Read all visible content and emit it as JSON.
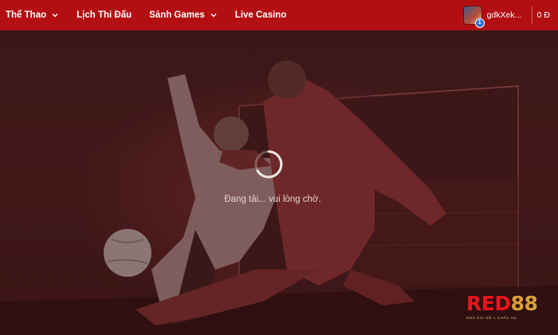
{
  "nav": {
    "items": [
      {
        "label": "Thể Thao",
        "has_dropdown": true
      },
      {
        "label": "Lịch Thi Đấu",
        "has_dropdown": false
      },
      {
        "label": "Sảnh Games",
        "has_dropdown": true
      },
      {
        "label": "Live Casino",
        "has_dropdown": false
      }
    ]
  },
  "user": {
    "name": "gdkXek...",
    "badge": "1",
    "balance": "0 Đ"
  },
  "loading": {
    "text": "Đang tải... vui lòng chờ."
  },
  "brand": {
    "part1": "RED",
    "part2": "88",
    "tagline": "NHÀ CÁI SỐ 1 CHÂU ÂU",
    "color_primary": "#e8141c",
    "color_accent": "#d9a23a"
  },
  "theme": {
    "navbar_bg": "#b30f12",
    "page_bg": "#3a1a1b"
  }
}
